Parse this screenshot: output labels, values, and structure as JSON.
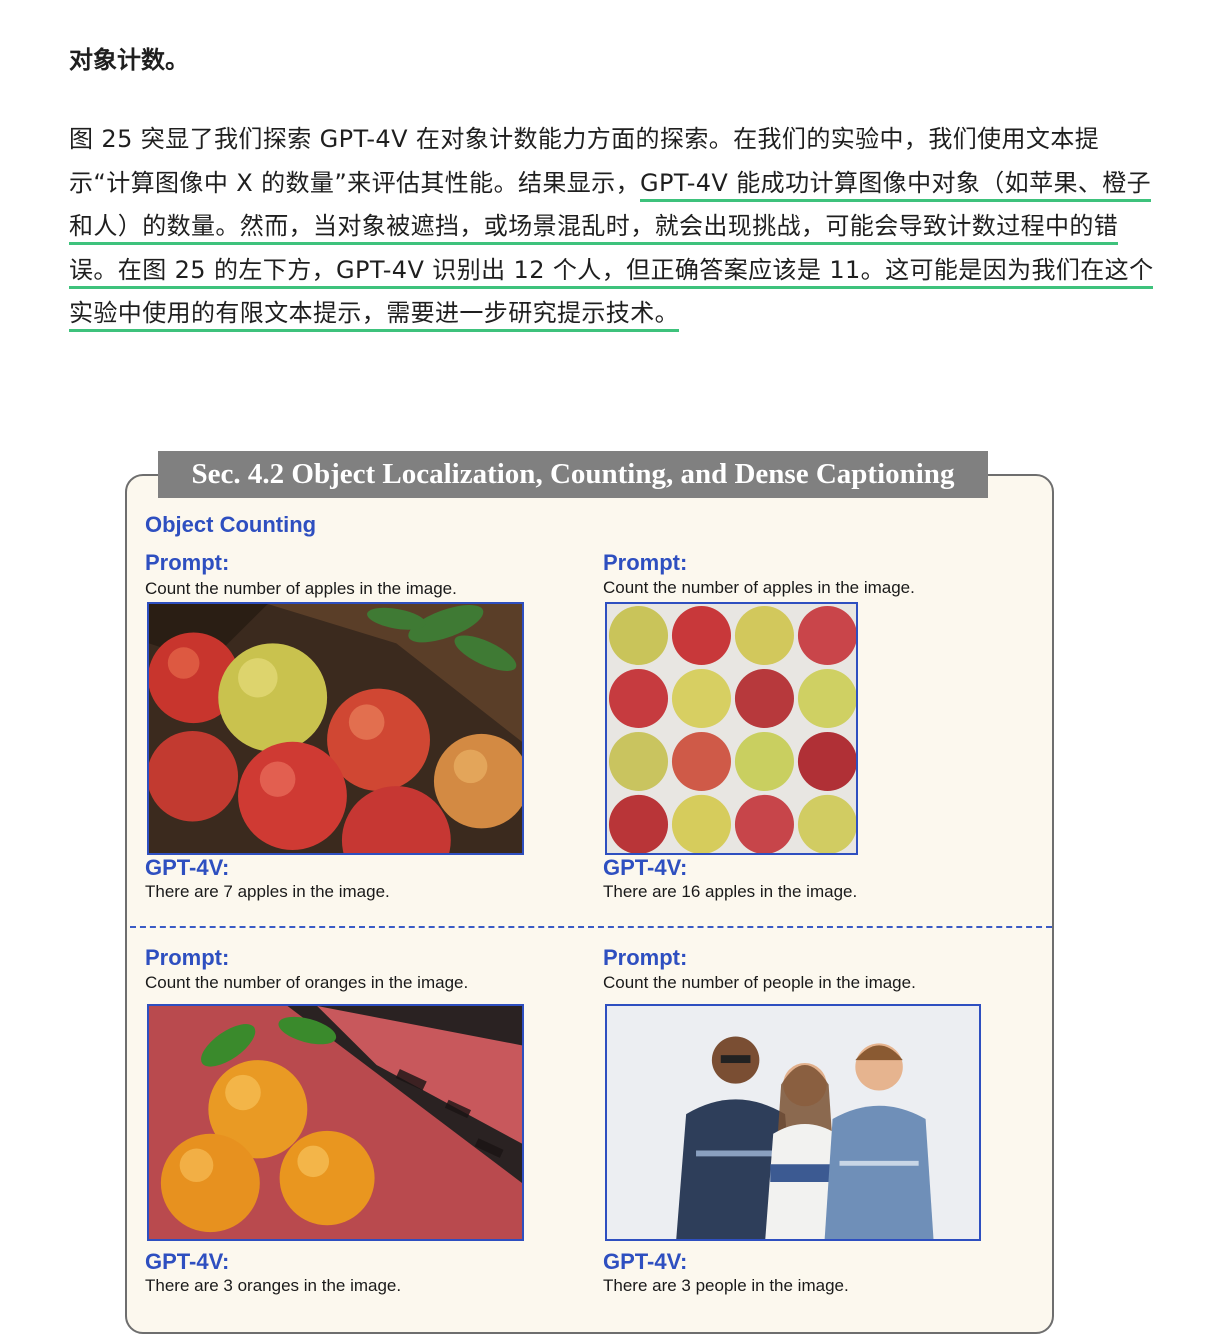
{
  "heading": "对象计数。",
  "paragraph": {
    "plain": "图 25 突显了我们探索 GPT-4V 在对象计数能力方面的探索。在我们的实验中，我们使用文本提示“计算图像中 X 的数量”来评估其性能。结果显示，",
    "highlighted": "GPT-4V 能成功计算图像中对象（如苹果、橙子和人）的数量。然而，当对象被遮挡，或场景混乱时，就会出现挑战，可能会导致计数过程中的错误。在图 25 的左下方，GPT-4V 识别出 12 个人，但正确答案应该是 11。这可能是因为我们在这个实验中使用的有限文本提示，需要进一步研究提示技术。"
  },
  "figure": {
    "title": "Sec. 4.2 Object Localization, Counting, and Dense Captioning",
    "section": "Object Counting",
    "prompt_label": "Prompt:",
    "answer_label": "GPT-4V:",
    "panels": [
      {
        "prompt": "Count the number of apples in the image.",
        "answer": "There are 7 apples in the image.",
        "image": "apples-on-wood-photo"
      },
      {
        "prompt": "Count the number of apples in the image.",
        "answer": "There are 16 apples in the image.",
        "image": "apple-grid-photo"
      },
      {
        "prompt": "Count the number of oranges in the image.",
        "answer": "There are 3 oranges in the image.",
        "image": "oranges-photo"
      },
      {
        "prompt": "Count the number of people in the image.",
        "answer": "There are 3 people in the image.",
        "image": "three-people-photo"
      }
    ]
  },
  "colors": {
    "accent_blue": "#2e4fc0",
    "highlight_green": "#3ec27c",
    "figure_bg": "#fcf8ee"
  }
}
